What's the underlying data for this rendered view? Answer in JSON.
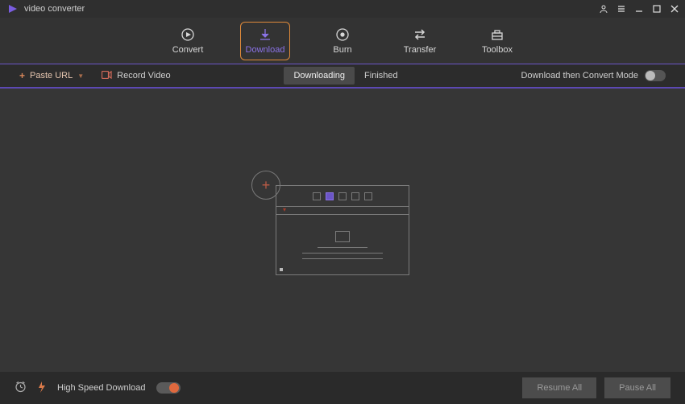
{
  "app": {
    "title": "video converter"
  },
  "nav": {
    "items": [
      {
        "label": "Convert"
      },
      {
        "label": "Download"
      },
      {
        "label": "Burn"
      },
      {
        "label": "Transfer"
      },
      {
        "label": "Toolbox"
      }
    ],
    "active_index": 1
  },
  "toolbar": {
    "paste_url_label": "Paste URL",
    "record_video_label": "Record Video",
    "segments": [
      {
        "label": "Downloading"
      },
      {
        "label": "Finished"
      }
    ],
    "active_segment": 0,
    "mode_label": "Download then Convert Mode",
    "mode_on": false
  },
  "footer": {
    "high_speed_label": "High Speed Download",
    "high_speed_on": true,
    "resume_all_label": "Resume All",
    "pause_all_label": "Pause All"
  },
  "colors": {
    "accent": "#8a72e6",
    "accent_border": "#e08a3a",
    "divider": "#6b55c7",
    "warm": "#d97a4a"
  }
}
